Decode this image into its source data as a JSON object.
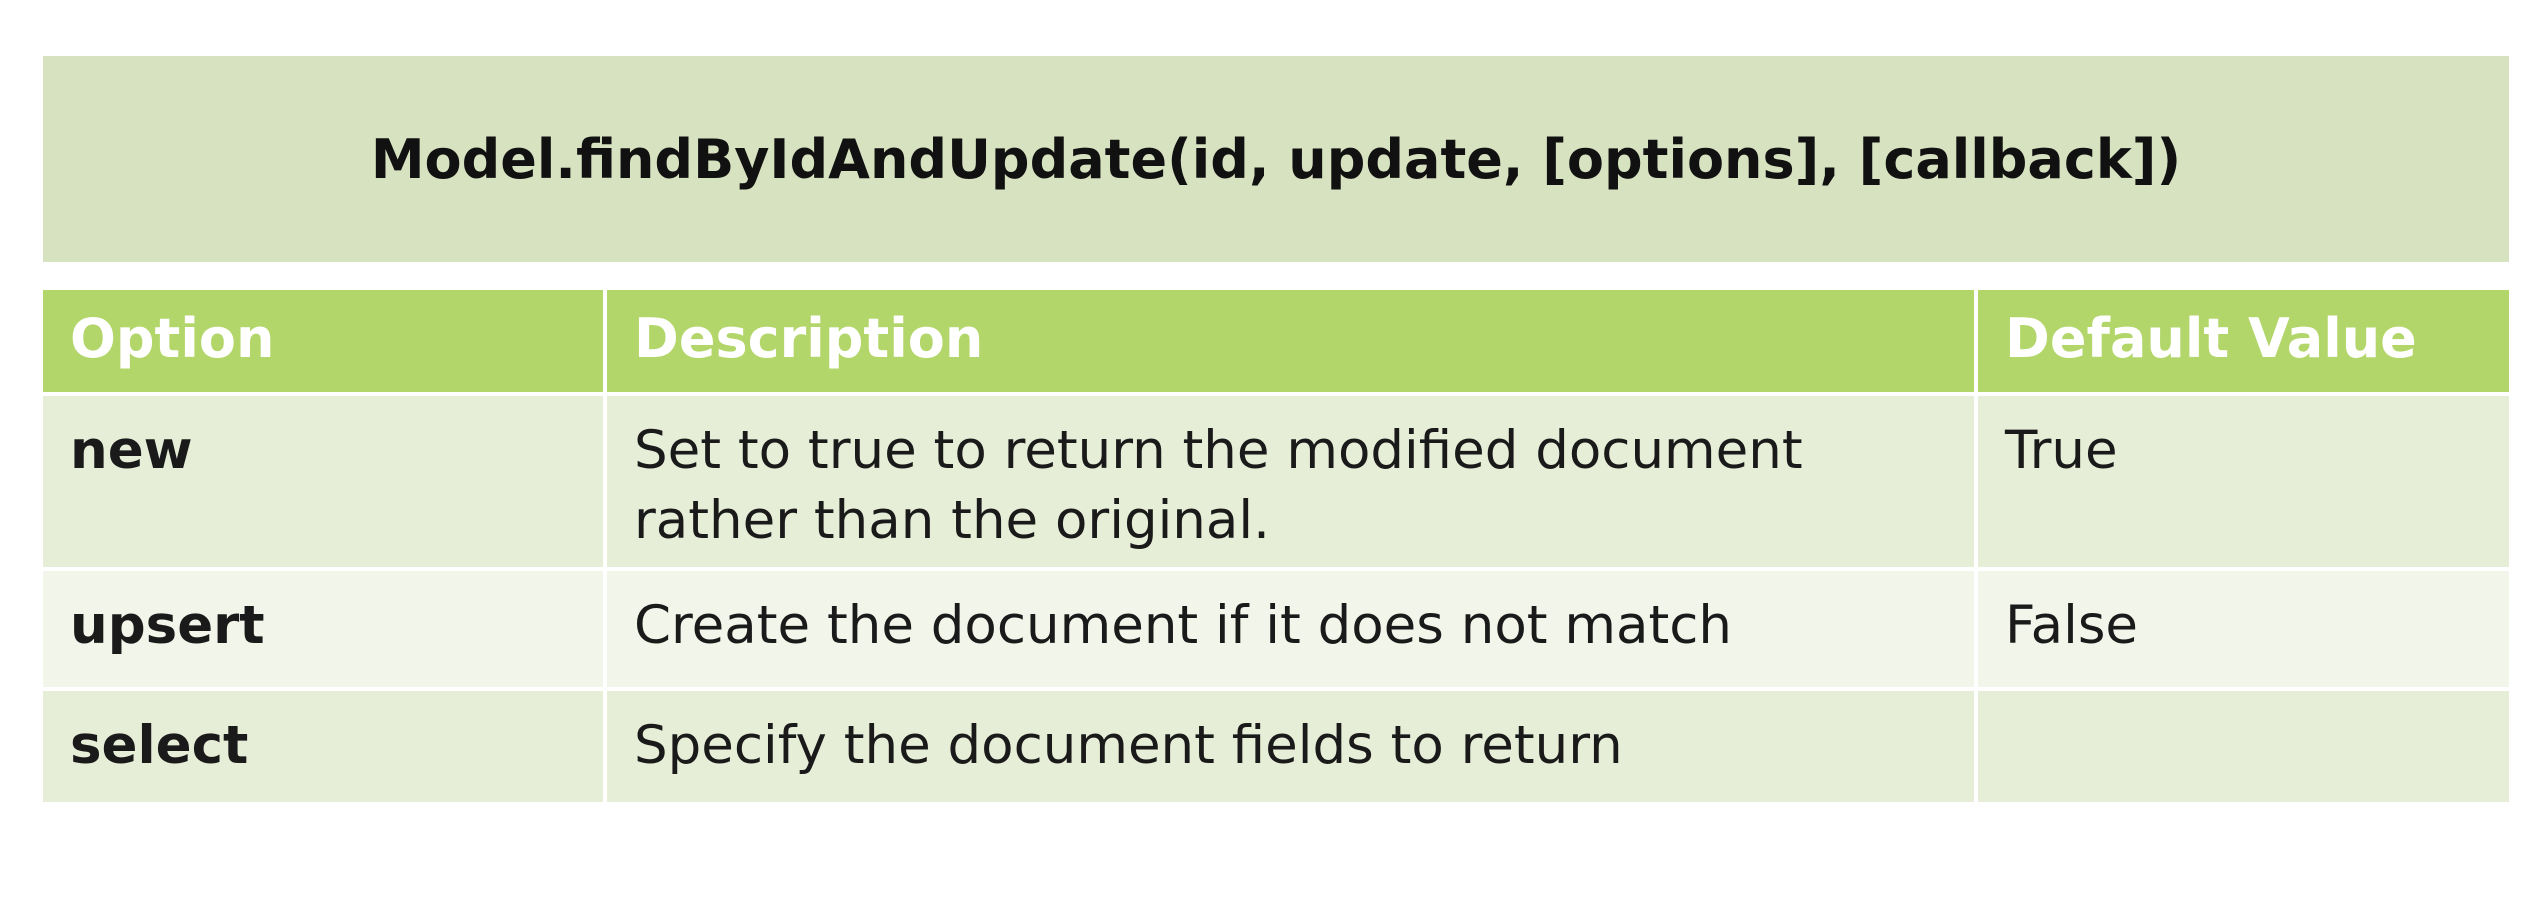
{
  "title": "Model.findByIdAndUpdate(id, update, [options], [callback])",
  "table": {
    "headers": [
      "Option",
      "Description",
      "Default Value"
    ],
    "rows": [
      {
        "option": "new",
        "description": "Set to true to return the modified document rather than the original.",
        "default": "True"
      },
      {
        "option": "upsert",
        "description": "Create the document if it does not match",
        "default": "False"
      },
      {
        "option": "select",
        "description": "Specify the document fields to return",
        "default": ""
      }
    ]
  },
  "colors": {
    "title_bg": "#d6e2c0",
    "header_bg": "#b3d66a",
    "row_odd_bg": "#e7eed8",
    "row_even_bg": "#f2f5ea"
  }
}
